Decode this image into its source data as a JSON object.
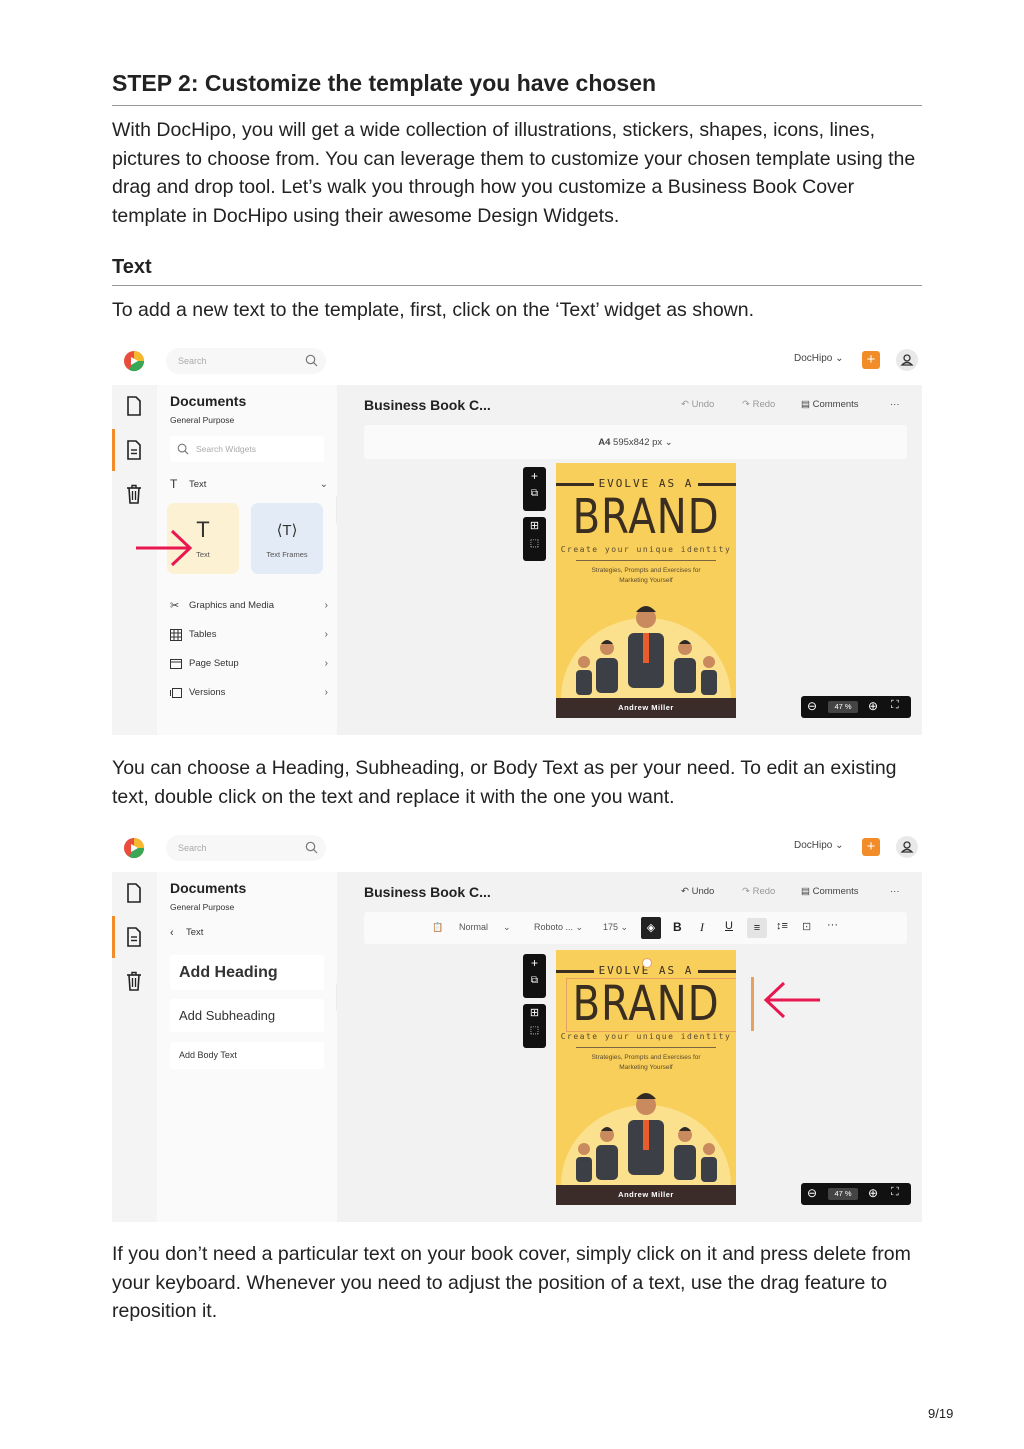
{
  "heading": "STEP 2: Customize the template you have chosen",
  "intro": "With DocHipo, you will get a wide collection of illustrations, stickers, shapes, icons, lines, pictures to choose from. You can leverage them to customize your chosen template using the drag and drop tool. Let’s walk you through how you customize a Business Book Cover template in DocHipo using their awesome Design Widgets.",
  "subheading": "Text",
  "instruction_1": "To add a new text to the template, first, click on the ‘Text’ widget as shown.",
  "instruction_2": "You can choose a Heading, Subheading, or Body Text as per your need. To edit an existing text, double click on the text and replace it with the one you want.",
  "instruction_3": "If you don’t need a particular text on your book cover, simply click on it and press delete from your keyboard. Whenever you need to adjust the position of a text, use the drag feature to reposition it.",
  "page_number": "9/19",
  "colors": {
    "accent": "#f28c28",
    "arrow": "#e8174f",
    "cover": "#f8cf5a"
  },
  "app": {
    "search_placeholder": "Search",
    "brand_menu": "DochHipo",
    "brand_menu_label": "DocHipo ⌄",
    "panel_title": "Documents",
    "panel_subtitle": "General Purpose",
    "search_widgets_placeholder": "Search Widgets",
    "doc_title": "Business Book C...",
    "undo": "Undo",
    "redo": "Redo",
    "comments": "Comments",
    "more": "···",
    "page_size_bold": "A4",
    "page_size": "595x842 px  ⌄",
    "zoom": "47 %"
  },
  "screen1": {
    "text_section": "Text",
    "card_text": "Text",
    "card_text_frames": "Text Frames",
    "menu": [
      {
        "label": "Graphics and Media",
        "icon": "graphics-icon"
      },
      {
        "label": "Tables",
        "icon": "table-icon"
      },
      {
        "label": "Page Setup",
        "icon": "page-setup-icon"
      },
      {
        "label": "Versions",
        "icon": "versions-icon"
      }
    ]
  },
  "screen2": {
    "back_label": "Text",
    "add_heading": "Add Heading",
    "add_subheading": "Add Subheading",
    "add_body": "Add Body Text",
    "toolbar": {
      "style": "Normal",
      "font": "Roboto ...",
      "size": "175",
      "bold": "B",
      "italic": "I",
      "underline": "U",
      "more": "···"
    }
  },
  "cover": {
    "top": "EVOLVE AS A",
    "title": "BRAND",
    "tagline": "Create your unique identity",
    "desc_line1": "Strategies, Prompts and Exercises for",
    "desc_line2": "Marketing Yourself",
    "author": "Andrew Miller"
  }
}
